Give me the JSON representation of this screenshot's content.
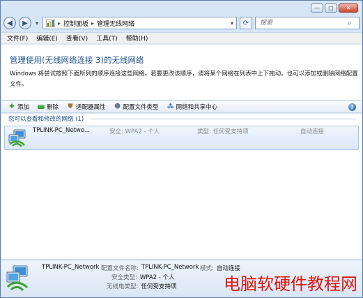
{
  "caption": {
    "minimize": "—",
    "maximize": "□",
    "close": "✕"
  },
  "nav": {
    "back": "◀",
    "forward": "▶",
    "address": {
      "crumbs": [
        "控制面板",
        "管理无线网络"
      ]
    },
    "search_placeholder": "搜索"
  },
  "menubar": {
    "items": [
      "文件(F)",
      "编辑(E)",
      "查看(V)",
      "工具(T)",
      "帮助(H)"
    ]
  },
  "header": {
    "title": "管理使用(无线网络连接 3)的无线网络",
    "description": "Windows 将尝试按照下面所列的顺序连接这些网络。若要更改该顺序，请将某个网络在列表中上下拖动。也可以添加或删除网络配置文件。"
  },
  "toolbar": {
    "add": "添加",
    "delete": "删除",
    "adapter": "适配器属性",
    "profile_type": "配置文件类型",
    "network_center": "网络和共享中心",
    "help": "?"
  },
  "list": {
    "group_label": "您可以查看和修改的网络 (1)",
    "rows": [
      {
        "name": "TPLINK-PC_Netwo...",
        "security": "安全: WPA2 - 个人",
        "type": "类型: 任何受支持项",
        "mode": "自动连接"
      }
    ]
  },
  "details": {
    "name": "TPLINK-PC_Network",
    "profile_label": "配置文件名称:",
    "profile_value": "TPLINK-PC_Network",
    "mode_label": "模式:",
    "mode_value": "自动连接",
    "security_label": "安全类型:",
    "security_value": "WPA2 - 个人",
    "radio_label": "无线电类型:",
    "radio_value": "任何受支持项"
  },
  "watermark": "电脑软硬件教程网"
}
